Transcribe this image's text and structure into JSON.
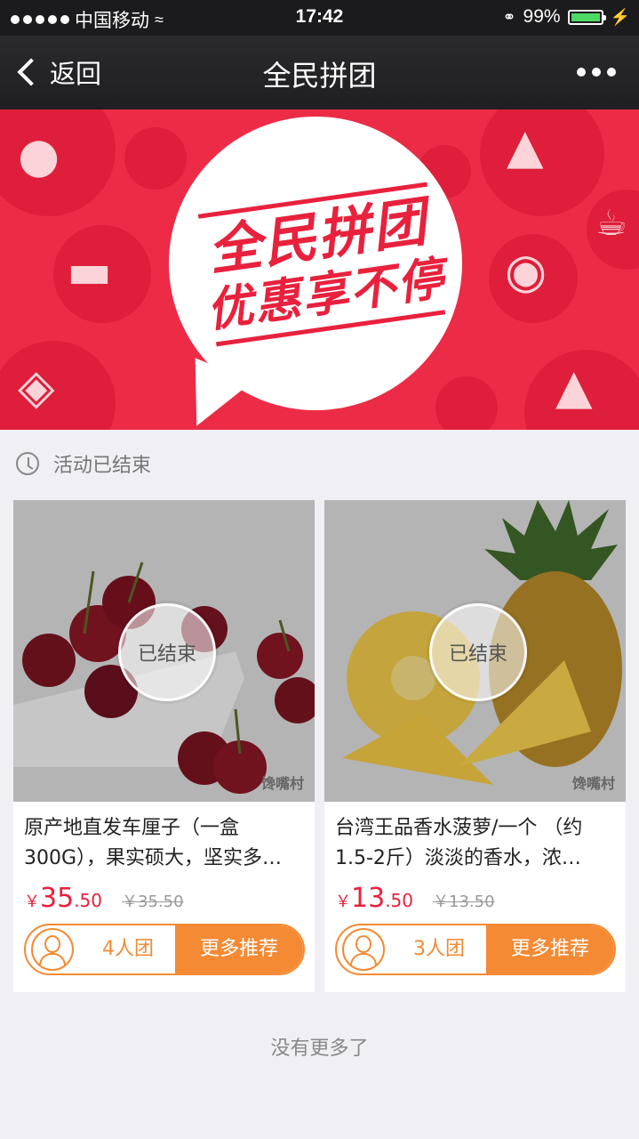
{
  "status_bar": {
    "carrier": "中国移动",
    "time": "17:42",
    "battery": "99%"
  },
  "nav": {
    "back_label": "返回",
    "title": "全民拼团"
  },
  "banner": {
    "slogan_line1": "全民拼团",
    "slogan_line2": "优惠享不停",
    "icons": [
      "bread-icon",
      "cap-icon",
      "drink-icon",
      "shoe-icon",
      "cherry-icon",
      "vegetable-icon",
      "dress-icon"
    ]
  },
  "activity": {
    "status_text": "活动已结束"
  },
  "products": [
    {
      "ended_label": "已结束",
      "watermark": "馋嘴村",
      "name": "原产地直发车厘子（一盒300G），果实硕大，坚实多…",
      "currency": "￥",
      "price_int": "35",
      "price_dec": ".50",
      "original_price": "￥35.50",
      "group_size": "4人团",
      "more_label": "更多推荐"
    },
    {
      "ended_label": "已结束",
      "watermark": "馋嘴村",
      "name": "台湾王品香水菠萝/一个 （约1.5-2斤）淡淡的香水，浓…",
      "currency": "￥",
      "price_int": "13",
      "price_dec": ".50",
      "original_price": "￥13.50",
      "group_size": "3人团",
      "more_label": "更多推荐"
    }
  ],
  "footer": {
    "no_more_text": "没有更多了"
  },
  "colors": {
    "accent_red": "#ec2c47",
    "accent_orange": "#f48a33"
  }
}
